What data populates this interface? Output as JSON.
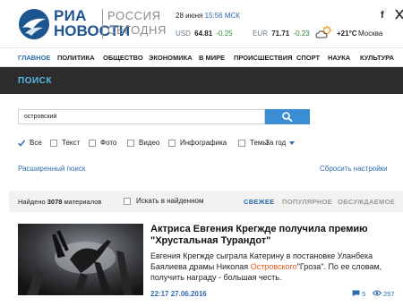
{
  "logo": {
    "ria": "РИА",
    "novosti": "НОВОСТИ",
    "russia": "РОССИЯ",
    "today": "СЕГОДНЯ"
  },
  "date": {
    "day": "28 июня",
    "time": "15:56 МСК"
  },
  "rates": [
    {
      "code": "USD",
      "value": "64.81",
      "change": "-0.25"
    },
    {
      "code": "EUR",
      "value": "71.71",
      "change": "-0.23"
    }
  ],
  "weather": {
    "temp": "+21°C",
    "city": "Москва",
    "icon": "cloud-sun-icon"
  },
  "social": {
    "facebook": "f",
    "twitter_icon": "twitter-icon"
  },
  "nav": [
    "ГЛАВНОЕ",
    "ПОЛИТИКА",
    "ОБЩЕСТВО",
    "ЭКОНОМИКА",
    "В МИРЕ",
    "ПРОИСШЕСТВИЯ",
    "СПОРТ",
    "НАУКА",
    "КУЛЬТУРА"
  ],
  "page_title": "ПОИСК",
  "search": {
    "value": "островский",
    "button_icon": "search-icon"
  },
  "filters": [
    {
      "label": "Все",
      "checked": true
    },
    {
      "label": "Текст",
      "checked": false
    },
    {
      "label": "Фото",
      "checked": false
    },
    {
      "label": "Видео",
      "checked": false
    },
    {
      "label": "Инфографика",
      "checked": false
    },
    {
      "label": "Темы",
      "checked": false
    }
  ],
  "by_year": "За год",
  "advanced_search": "Расширенный поиск",
  "reset_settings": "Сбросить настройки",
  "results": {
    "found_prefix": "Найдено",
    "count": "3078",
    "found_suffix": "материалов",
    "search_in_found": "Искать в найденном",
    "sort": [
      "СВЕЖЕЕ",
      "ПОПУЛЯРНОЕ",
      "ОБСУЖДАЕМОЕ"
    ]
  },
  "article": {
    "title": "Актриса Евгения Крегжде получила премию \"Хрустальная Турандот\"",
    "text_before": "Евгения Крегжде сыграла Катерину в постановке Уланбека Баялиева драмы Николая ",
    "text_highlight": "Островского",
    "text_after": "\"Гроза\". По ее словам, получить награду - большая честь.",
    "time": "22:17",
    "date": "27.06.2016",
    "comments": "5",
    "views": "257"
  },
  "colors": {
    "brand_blue": "#1d5591",
    "link_blue": "#2b6cb0",
    "search_button": "#3b8ed4",
    "dark_band": "#2c2c2c",
    "band_title": "#5bb6e8",
    "highlight": "#e05a1c",
    "positive": "#2c8a3a"
  }
}
